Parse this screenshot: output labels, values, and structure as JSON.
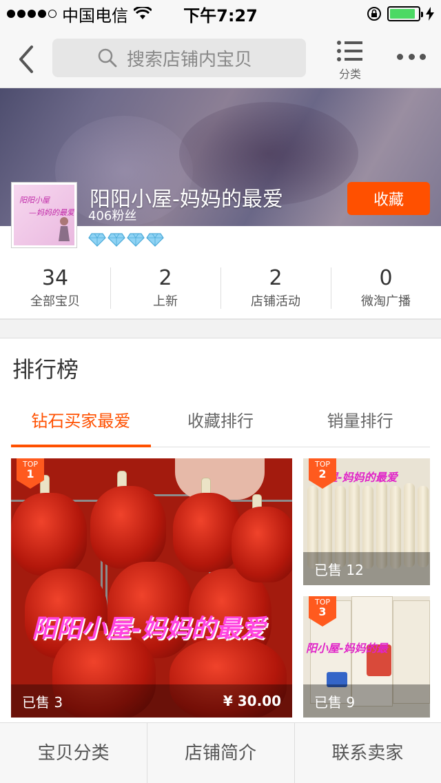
{
  "status_bar": {
    "carrier": "中国电信",
    "time": "下午7:27",
    "battery_level": 0.9
  },
  "nav": {
    "search_placeholder": "搜索店铺内宝贝",
    "category_label": "分类"
  },
  "shop": {
    "name": "阳阳小屋-妈妈的最爱",
    "fans": "406粉丝",
    "favorite_label": "收藏",
    "diamond_count": 4,
    "logo_text": [
      "阳阳小屋",
      "—妈妈的最爱"
    ]
  },
  "stats": [
    {
      "num": "34",
      "label": "全部宝贝"
    },
    {
      "num": "2",
      "label": "上新"
    },
    {
      "num": "2",
      "label": "店铺活动"
    },
    {
      "num": "0",
      "label": "微淘广播"
    }
  ],
  "ranking": {
    "title": "排行榜",
    "tabs": [
      "钻石买家最爱",
      "收藏排行",
      "销量排行"
    ],
    "active_tab": 0,
    "items": [
      {
        "badge_top": "TOP",
        "rank": "1",
        "sold": "已售 3",
        "price": "¥ 30.00",
        "watermark": "阳阳小屋-妈妈的最爱"
      },
      {
        "badge_top": "TOP",
        "rank": "2",
        "sold": "已售 12",
        "watermark": "屋-妈妈的最爱"
      },
      {
        "badge_top": "TOP",
        "rank": "3",
        "sold": "已售 9",
        "watermark": "阳小屋-妈妈的最"
      }
    ]
  },
  "bottom_bar": [
    "宝贝分类",
    "店铺简介",
    "联系卖家"
  ]
}
